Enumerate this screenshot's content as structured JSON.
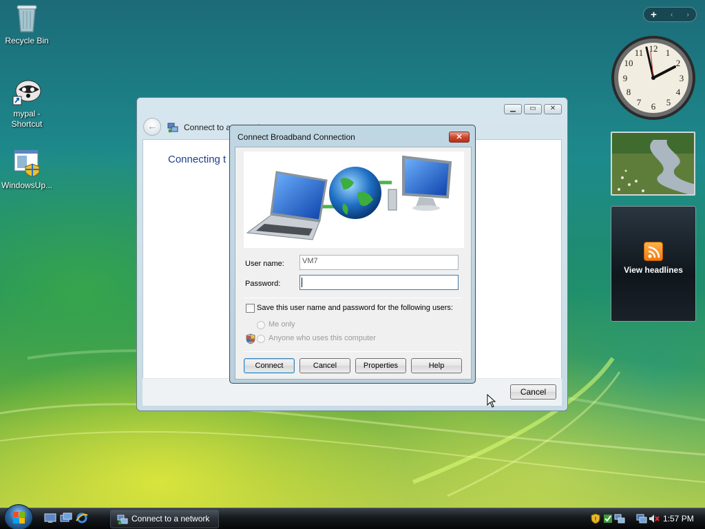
{
  "desktop": {
    "icons": [
      {
        "label": "Recycle Bin"
      },
      {
        "label": "mypal - Shortcut"
      },
      {
        "label": "WindowsUp..."
      }
    ]
  },
  "sidebar": {
    "controls": [
      "+",
      "‹",
      "›"
    ],
    "clock": {
      "time": "1:57"
    },
    "feed": {
      "label": "View headlines"
    }
  },
  "main_window": {
    "title": "Connect to a network",
    "heading": "Connecting t",
    "cancel_label": "Cancel"
  },
  "dialog": {
    "title": "Connect Broadband Connection",
    "close_label": "✕",
    "username_label": "User name:",
    "username_value": "VM7",
    "password_label": "Password:",
    "password_value": "",
    "save_label": "Save this user name and password for the following users:",
    "me_only_label": "Me only",
    "anyone_label": "Anyone who uses this computer",
    "buttons": {
      "connect": "Connect",
      "cancel": "Cancel",
      "properties": "Properties",
      "help": "Help"
    }
  },
  "taskbar": {
    "task_label": "Connect to a network",
    "time": "1:57 PM"
  },
  "colors": {
    "accent": "#1e3d8c",
    "close_red": "#d0472e",
    "taskbar": "#15191d"
  }
}
